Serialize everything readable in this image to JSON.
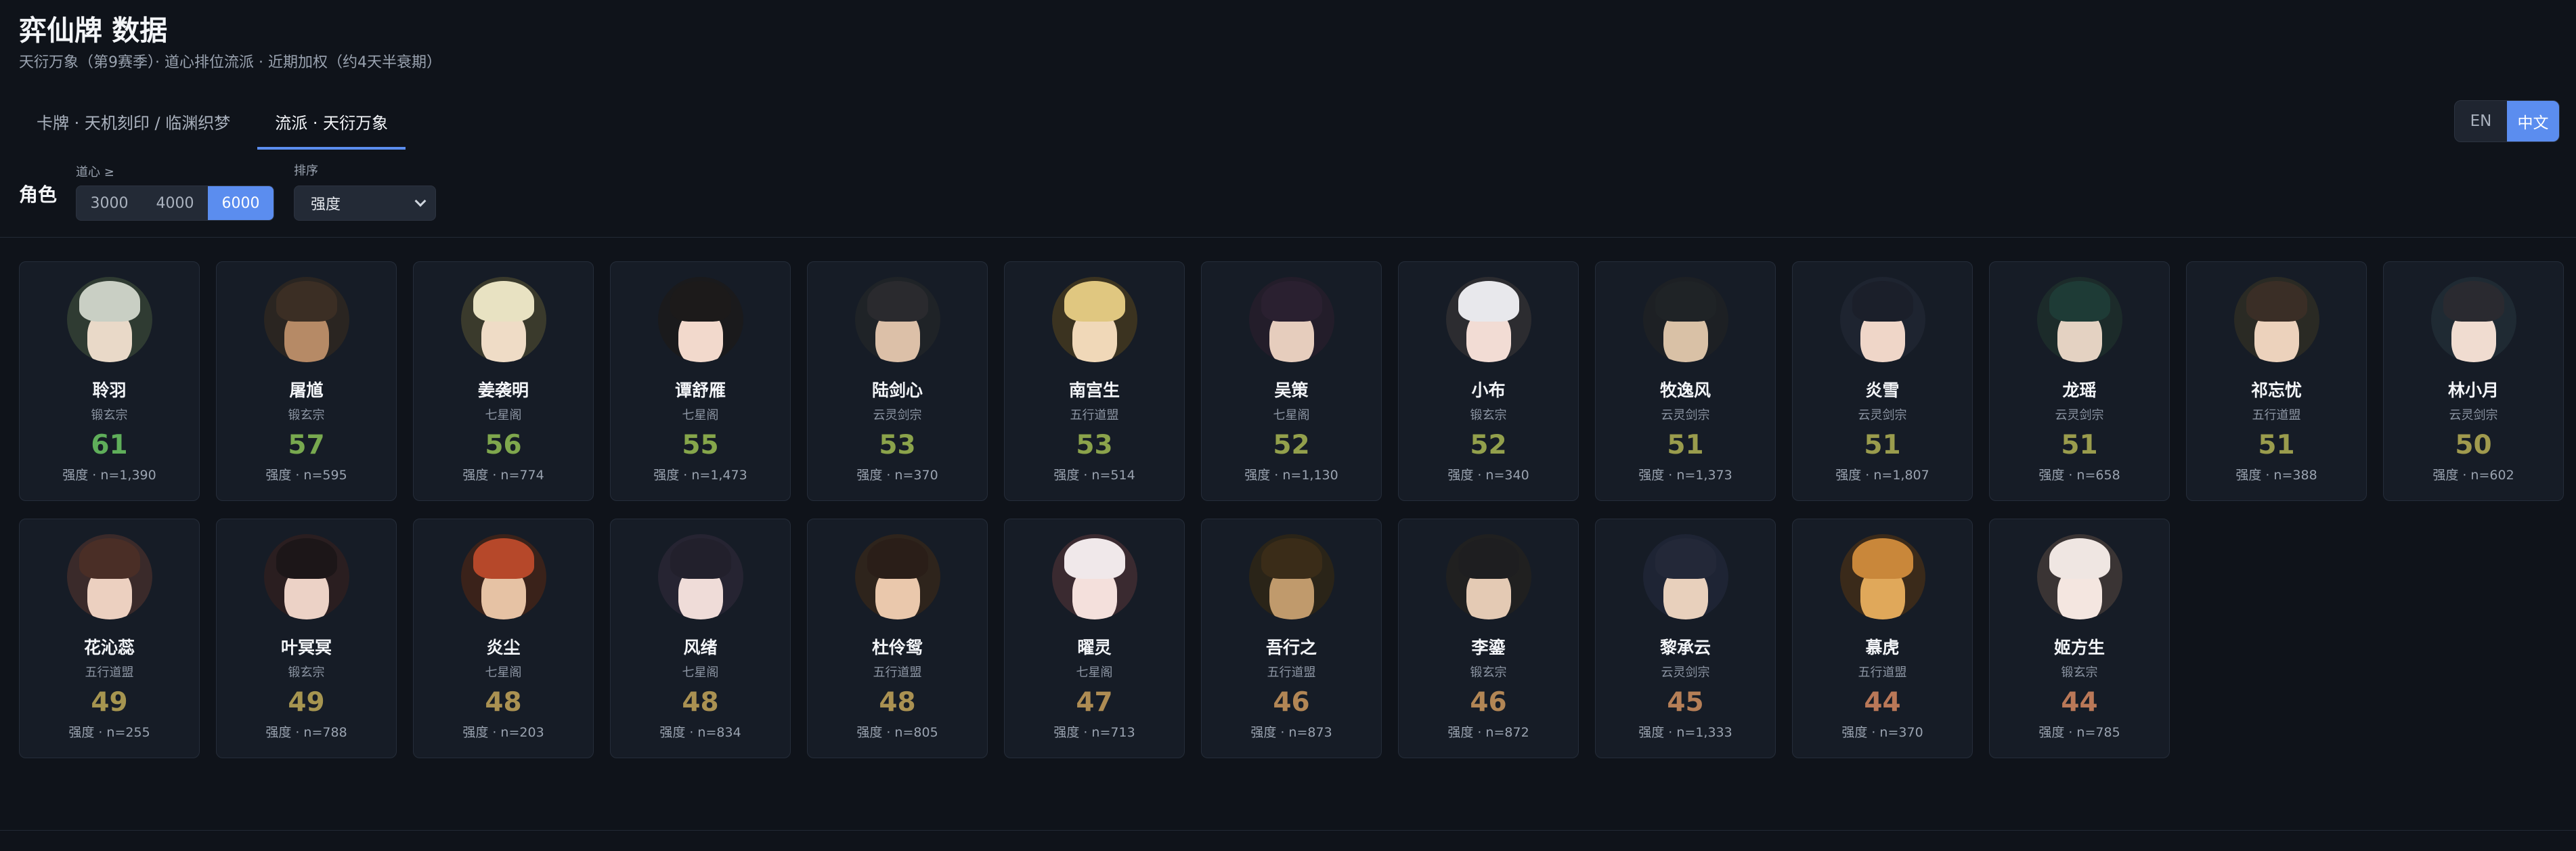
{
  "header": {
    "title": "弈仙牌 数据",
    "subtitle": "天衍万象（第9赛季）· 道心排位流派 · 近期加权（约4天半衰期）"
  },
  "tabs": [
    {
      "label": "卡牌 · 天机刻印 / 临渊织梦",
      "active": false
    },
    {
      "label": "流派 · 天衍万象",
      "active": true
    }
  ],
  "lang": {
    "en": "EN",
    "zh": "中文",
    "active": "zh"
  },
  "filters": {
    "section_label": "角色",
    "threshold_label": "道心 ≥",
    "thresholds": [
      "3000",
      "4000",
      "6000"
    ],
    "active_threshold": "6000",
    "sort_label": "排序",
    "sort_value": "强度"
  },
  "cards": [
    {
      "name": "聆羽",
      "sect": "锻玄宗",
      "score": "61",
      "meta": "强度 · n=1,390",
      "color": "#5fae5a",
      "avatar_bg": "#2f3b32",
      "hair": "#c9cfc4",
      "skin": "#e9d9c8"
    },
    {
      "name": "屠馗",
      "sect": "锻玄宗",
      "score": "57",
      "meta": "强度 · n=595",
      "color": "#78a94f",
      "avatar_bg": "#2a2521",
      "hair": "#3b2e24",
      "skin": "#b68a66"
    },
    {
      "name": "姜袭明",
      "sect": "七星阁",
      "score": "56",
      "meta": "强度 · n=774",
      "color": "#7fa74d",
      "avatar_bg": "#3a3a2c",
      "hair": "#e8e2c2",
      "skin": "#efdcc6"
    },
    {
      "name": "谭舒雁",
      "sect": "七星阁",
      "score": "55",
      "meta": "强度 · n=1,473",
      "color": "#86a64b",
      "avatar_bg": "#1a1a1c",
      "hair": "#1c1a1a",
      "skin": "#f2d9cc"
    },
    {
      "name": "陆剑心",
      "sect": "云灵剑宗",
      "score": "53",
      "meta": "强度 · n=370",
      "color": "#8ba34b",
      "avatar_bg": "#1f2327",
      "hair": "#2a2a2e",
      "skin": "#dcc0a8"
    },
    {
      "name": "南宫生",
      "sect": "五行道盟",
      "score": "53",
      "meta": "强度 · n=514",
      "color": "#8ba34b",
      "avatar_bg": "#3b3320",
      "hair": "#e0c780",
      "skin": "#f0d8b8"
    },
    {
      "name": "吴策",
      "sect": "七星阁",
      "score": "52",
      "meta": "强度 · n=1,130",
      "color": "#93a04c",
      "avatar_bg": "#231d2a",
      "hair": "#2a2030",
      "skin": "#e6cdbd"
    },
    {
      "name": "小布",
      "sect": "锻玄宗",
      "score": "52",
      "meta": "强度 · n=340",
      "color": "#93a04c",
      "avatar_bg": "#2c2c30",
      "hair": "#e8e8ec",
      "skin": "#f2dcd4"
    },
    {
      "name": "牧逸风",
      "sect": "云灵剑宗",
      "score": "51",
      "meta": "强度 · n=1,373",
      "color": "#9a9c4d",
      "avatar_bg": "#1d2024",
      "hair": "#1f2326",
      "skin": "#d9c1a6"
    },
    {
      "name": "炎雪",
      "sect": "云灵剑宗",
      "score": "51",
      "meta": "强度 · n=1,807",
      "color": "#9a9c4d",
      "avatar_bg": "#1e2430",
      "hair": "#1b1f2a",
      "skin": "#efd6c8"
    },
    {
      "name": "龙瑶",
      "sect": "云灵剑宗",
      "score": "51",
      "meta": "强度 · n=658",
      "color": "#9a9c4d",
      "avatar_bg": "#1c2b2a",
      "hair": "#1e3b36",
      "skin": "#e4d2c2"
    },
    {
      "name": "祁忘忧",
      "sect": "五行道盟",
      "score": "51",
      "meta": "强度 · n=388",
      "color": "#9a9c4d",
      "avatar_bg": "#2a2a24",
      "hair": "#3a2e26",
      "skin": "#ecd2bc"
    },
    {
      "name": "林小月",
      "sect": "云灵剑宗",
      "score": "50",
      "meta": "强度 · n=602",
      "color": "#a09a4e",
      "avatar_bg": "#1f2a33",
      "hair": "#2a2a30",
      "skin": "#f0dcd0"
    },
    {
      "name": "花沁蕊",
      "sect": "五行道盟",
      "score": "49",
      "meta": "强度 · n=255",
      "color": "#a69550",
      "avatar_bg": "#3a2a2a",
      "hair": "#4a2e26",
      "skin": "#ecd0c0"
    },
    {
      "name": "叶冥冥",
      "sect": "锻玄宗",
      "score": "49",
      "meta": "强度 · n=788",
      "color": "#a69550",
      "avatar_bg": "#2a1e20",
      "hair": "#1c1618",
      "skin": "#ecd2c6"
    },
    {
      "name": "炎尘",
      "sect": "七星阁",
      "score": "48",
      "meta": "强度 · n=203",
      "color": "#aa9152",
      "avatar_bg": "#3a221a",
      "hair": "#b6482a",
      "skin": "#e6c2a4"
    },
    {
      "name": "风绪",
      "sect": "七星阁",
      "score": "48",
      "meta": "强度 · n=834",
      "color": "#aa9152",
      "avatar_bg": "#262432",
      "hair": "#22202c",
      "skin": "#efdcd8"
    },
    {
      "name": "杜伶鸳",
      "sect": "五行道盟",
      "score": "48",
      "meta": "强度 · n=805",
      "color": "#aa9152",
      "avatar_bg": "#2e241c",
      "hair": "#2a1e18",
      "skin": "#eac8ac"
    },
    {
      "name": "曜灵",
      "sect": "七星阁",
      "score": "47",
      "meta": "强度 · n=713",
      "color": "#ae8c53",
      "avatar_bg": "#3a2a30",
      "hair": "#f0e8ea",
      "skin": "#f4e0dc"
    },
    {
      "name": "吾行之",
      "sect": "五行道盟",
      "score": "46",
      "meta": "强度 · n=873",
      "color": "#b28655",
      "avatar_bg": "#2a2418",
      "hair": "#3a2c18",
      "skin": "#c09a6c"
    },
    {
      "name": "李鎏",
      "sect": "锻玄宗",
      "score": "46",
      "meta": "强度 · n=872",
      "color": "#b28655",
      "avatar_bg": "#202020",
      "hair": "#1e1e20",
      "skin": "#e4cab4"
    },
    {
      "name": "黎承云",
      "sect": "云灵剑宗",
      "score": "45",
      "meta": "强度 · n=1,333",
      "color": "#b67f57",
      "avatar_bg": "#1e2434",
      "hair": "#232838",
      "skin": "#e8d0bc"
    },
    {
      "name": "慕虎",
      "sect": "五行道盟",
      "score": "44",
      "meta": "强度 · n=370",
      "color": "#ba7858",
      "avatar_bg": "#3a2a1a",
      "hair": "#c9873a",
      "skin": "#e0a85a"
    },
    {
      "name": "姬方生",
      "sect": "锻玄宗",
      "score": "44",
      "meta": "强度 · n=785",
      "color": "#ba7858",
      "avatar_bg": "#3a3434",
      "hair": "#efe6e2",
      "skin": "#f4e6e0"
    }
  ]
}
